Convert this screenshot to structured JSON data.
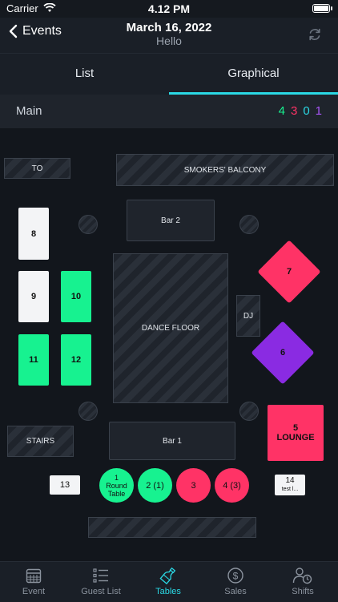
{
  "status_bar": {
    "carrier": "Carrier",
    "time": "4.12 PM"
  },
  "header": {
    "back_label": "Events",
    "title": "March 16, 2022",
    "subtitle": "Hello"
  },
  "tabs": [
    {
      "label": "List",
      "active": false
    },
    {
      "label": "Graphical",
      "active": true
    }
  ],
  "section": {
    "title": "Main",
    "counts": [
      {
        "value": "4",
        "color": "#17f290"
      },
      {
        "value": "3",
        "color": "#ff3366"
      },
      {
        "value": "0",
        "color": "#2ad8e4"
      },
      {
        "value": "1",
        "color": "#a855f7"
      }
    ]
  },
  "floor": {
    "areas": {
      "to": "TO",
      "smokers_balcony": "SMOKERS' BALCONY",
      "bar2": "Bar 2",
      "dance_floor": "DANCE FLOOR",
      "dj": "DJ",
      "stairs": "STAIRS",
      "bar1": "Bar 1"
    },
    "tables": {
      "t8": "8",
      "t9": "9",
      "t10": "10",
      "t11": "11",
      "t12": "12",
      "t7": "7",
      "t6": "6",
      "t5_num": "5",
      "t5_name": "LOUNGE",
      "t13": "13",
      "t1_num": "1",
      "t1_name": "Round Table",
      "t2": "2 (1)",
      "t3": "3",
      "t4": "4 (3)",
      "t14_num": "14",
      "t14_name": "test l..."
    }
  },
  "nav": [
    {
      "label": "Event",
      "icon": "calendar-icon",
      "active": false
    },
    {
      "label": "Guest List",
      "icon": "list-icon",
      "active": false
    },
    {
      "label": "Tables",
      "icon": "bottle-icon",
      "active": true
    },
    {
      "label": "Sales",
      "icon": "dollar-icon",
      "active": false
    },
    {
      "label": "Shifts",
      "icon": "user-clock-icon",
      "active": false
    }
  ]
}
